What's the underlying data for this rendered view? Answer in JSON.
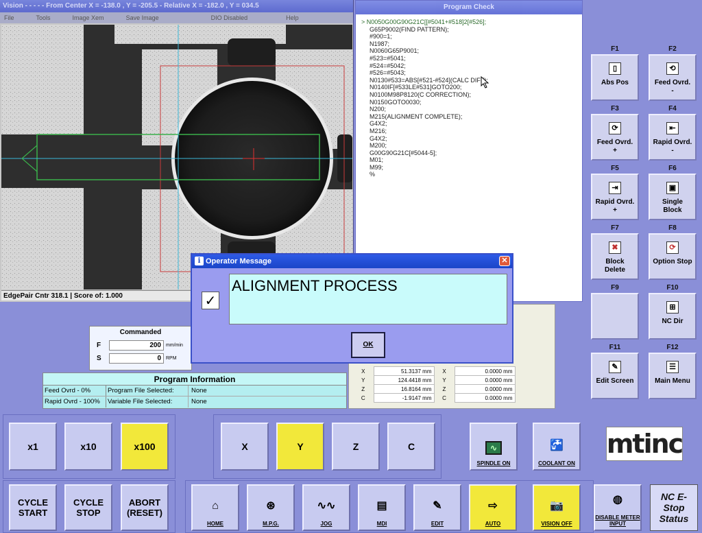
{
  "vision": {
    "title": "Vision - - - - - From Center X = -138.0 , Y = -205.5 - Relative X = -182.0 , Y = 034.5",
    "menu": [
      "File",
      "Tools",
      "Image Xem",
      "Save Image",
      "DIO Disabled",
      "Help"
    ],
    "status": "EdgePair Cntr 318.1 | Score of: 1.000"
  },
  "program_check": {
    "title": "Program Check",
    "lines": [
      "N0050G00G90G21C[[#5041+#518]2[#526];",
      "G65P9002(FIND PATTERN);",
      "#900=1;",
      "N1987;",
      "N0060G65P9001;",
      "#523=#5041;",
      "#524=#5042;",
      "#526=#5043;",
      "N0130#533=ABS[#521-#524](CALC DIFF);",
      "N0140IF[#533LE#531]GOTO200;",
      "N0100M98P8120(C CORRECTION);",
      "N0150GOTO0030;",
      "N200;",
      "M215(ALIGNMENT COMPLETE);",
      "G4X2;",
      "M216;",
      "G4X2;",
      "M200;",
      "G00G90G21C[#5044-5];",
      "M01;",
      "M99;",
      "%"
    ]
  },
  "fkeys": [
    {
      "key": "F1",
      "label": "Abs Pos",
      "icon": "abs-pos-icon"
    },
    {
      "key": "F2",
      "label": "Feed Ovrd.\n-",
      "icon": "feed-ovrd-minus-icon"
    },
    {
      "key": "F3",
      "label": "Feed Ovrd.\n+",
      "icon": "feed-ovrd-plus-icon"
    },
    {
      "key": "F4",
      "label": "Rapid Ovrd.\n-",
      "icon": "rapid-ovrd-minus-icon"
    },
    {
      "key": "F5",
      "label": "Rapid Ovrd.\n+",
      "icon": "rapid-ovrd-plus-icon"
    },
    {
      "key": "F6",
      "label": "Single\nBlock",
      "icon": "single-block-icon"
    },
    {
      "key": "F7",
      "label": "Block\nDelete",
      "icon": "block-delete-icon"
    },
    {
      "key": "F8",
      "label": "Option Stop",
      "icon": "option-stop-icon"
    },
    {
      "key": "F9",
      "label": "",
      "icon": ""
    },
    {
      "key": "F10",
      "label": "NC Dir",
      "icon": "nc-dir-icon"
    },
    {
      "key": "F11",
      "label": "Edit Screen",
      "icon": "edit-screen-icon"
    },
    {
      "key": "F12",
      "label": "Main Menu",
      "icon": "main-menu-icon"
    }
  ],
  "commanded": {
    "title": "Commanded",
    "f_label": "F",
    "f_value": "200",
    "f_unit": "mm/min",
    "s_label": "S",
    "s_value": "0",
    "s_unit": "RPM"
  },
  "program_info": {
    "title": "Program Information",
    "rows": [
      {
        "override": "Feed Ovrd - 0%",
        "field": "Program File Selected:",
        "value": "None"
      },
      {
        "override": "Rapid Ovrd - 100%",
        "field": "Variable File Selected:",
        "value": "None"
      }
    ]
  },
  "positions": [
    {
      "axis": "X",
      "value": "51.3137",
      "unit": "mm",
      "axis2": "X",
      "value2": "0.0000",
      "unit2": "mm"
    },
    {
      "axis": "Y",
      "value": "124.4418",
      "unit": "mm",
      "axis2": "Y",
      "value2": "0.0000",
      "unit2": "mm"
    },
    {
      "axis": "Z",
      "value": "16.8164",
      "unit": "mm",
      "axis2": "Z",
      "value2": "0.0000",
      "unit2": "mm"
    },
    {
      "axis": "C",
      "value": "-1.9147",
      "unit": "mm",
      "axis2": "C",
      "value2": "0.0000",
      "unit2": "mm"
    }
  ],
  "dialog": {
    "title": "Operator Message",
    "message": "ALIGNMENT PROCESS",
    "check": "✓",
    "ok_label": "OK"
  },
  "jog": {
    "increments": [
      "x1",
      "x10",
      "x100"
    ],
    "active_increment": "x100",
    "axes": [
      "X",
      "Y",
      "Z",
      "C"
    ],
    "active_axis": "Y"
  },
  "buttons": {
    "spindle": "SPINDLE ON",
    "coolant": "COOLANT ON",
    "cycle_start": "CYCLE START",
    "cycle_stop": "CYCLE STOP",
    "abort": "ABORT (RESET)",
    "home": "HOME",
    "mpg": "M.P.G.",
    "jog": "JOG",
    "mdi": "MDI",
    "edit": "EDIT",
    "auto": "AUTO",
    "vision_off": "VISION OFF",
    "disable_meter": "DISABLE METER INPUT"
  },
  "logo": "mtinc",
  "estop": "NC E-Stop Status",
  "colors": {
    "active": "#f2e83a",
    "panel": "#8a8fd8",
    "dialog_title": "#1b46c8"
  }
}
